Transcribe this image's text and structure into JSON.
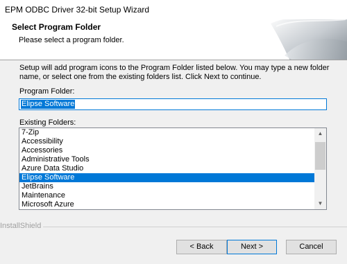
{
  "window": {
    "title": "EPM ODBC Driver 32-bit Setup Wizard"
  },
  "header": {
    "title": "Select Program Folder",
    "subtitle": "Please select a program folder."
  },
  "description": "Setup will add program icons to the Program Folder listed below.  You may type a new folder name, or select one from the existing folders list.  Click Next to continue.",
  "program_folder": {
    "label": "Program Folder:",
    "value": "Elipse Software"
  },
  "existing_folders": {
    "label": "Existing Folders:",
    "items": [
      "7-Zip",
      "Accessibility",
      "Accessories",
      "Administrative Tools",
      "Azure Data Studio",
      "Elipse Software",
      "JetBrains",
      "Maintenance",
      "Microsoft Azure"
    ],
    "selected": "Elipse Software"
  },
  "brand": "InstallShield",
  "buttons": {
    "back": "< Back",
    "next": "Next >",
    "cancel": "Cancel"
  },
  "colors": {
    "accent": "#0078d7",
    "background": "#f0f0f0"
  }
}
